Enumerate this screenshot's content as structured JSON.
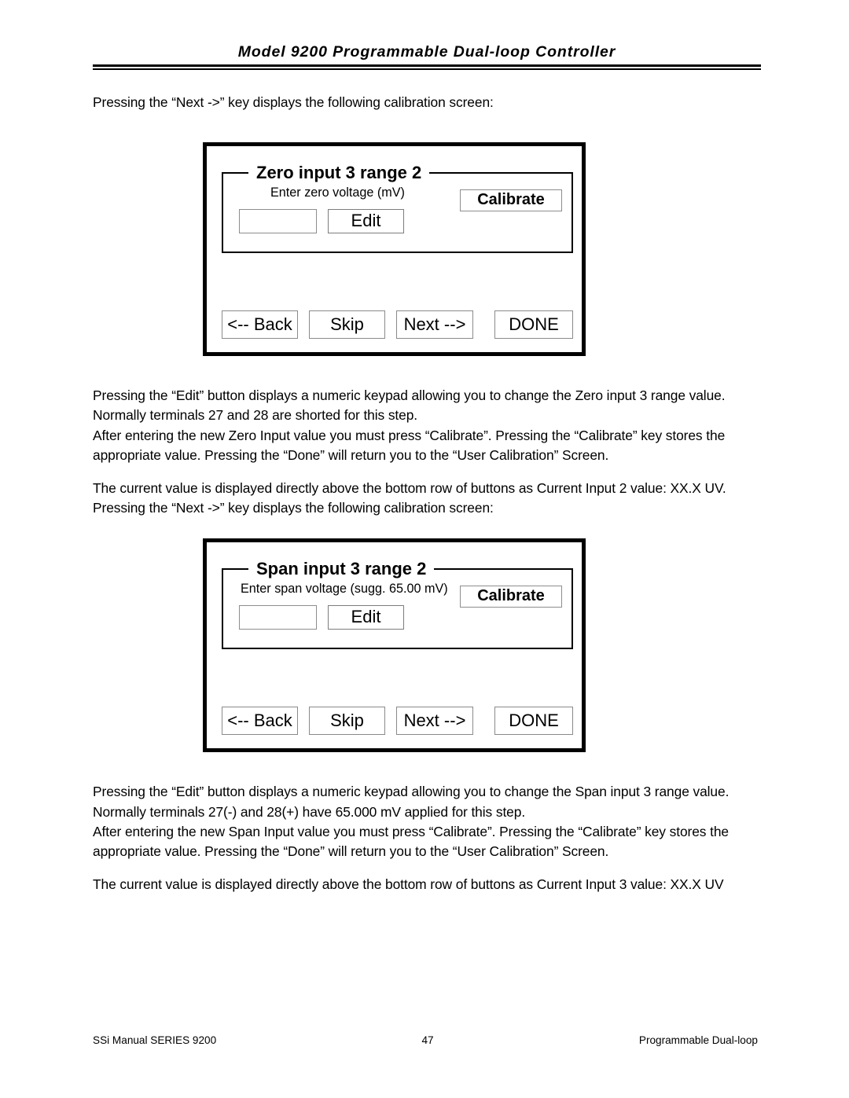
{
  "header": {
    "title": "Model 9200 Programmable Dual-loop Controller"
  },
  "body": {
    "intro_paragraph": "Pressing the “Next ->” key displays the following calibration screen:",
    "zero_paragraph_1": "Pressing the “Edit” button displays a numeric keypad allowing you to change the Zero input 3 range value. Normally terminals 27 and 28 are shorted for this step.",
    "zero_paragraph_2": "After entering the new Zero Input value you must press “Calibrate”. Pressing the “Calibrate” key stores the appropriate value. Pressing the “Done” will return you to the “User Calibration” Screen.",
    "zero_current_value": "The current value is displayed directly above the bottom row of buttons as Current Input 2 value: XX.X UV.",
    "zero_next_prompt": "Pressing the “Next ->” key displays the following calibration screen:",
    "span_paragraph_1": "Pressing the “Edit” button displays a numeric keypad allowing you to change the Span input 3 range value. Normally terminals 27(-) and 28(+) have 65.000 mV applied for this step.",
    "span_paragraph_2": "After entering the new Span Input value you must press “Calibrate”. Pressing the “Calibrate” key stores the appropriate value. Pressing the “Done” will return you to the “User Calibration” Screen.",
    "span_current_value": "The current value is displayed directly above the bottom row of buttons as Current Input 3 value: XX.X UV"
  },
  "dialogs": [
    {
      "legend": "Zero input 3 range 2",
      "prompt": "Enter zero voltage (mV)",
      "value": "",
      "edit_label": "Edit",
      "calibrate_label": "Calibrate",
      "buttons": [
        "<-- Back",
        "Skip",
        "Next -->",
        "DONE"
      ]
    },
    {
      "legend": "Span input 3 range 2",
      "prompt": "Enter span voltage (sugg. 65.00 mV)",
      "value": "",
      "edit_label": "Edit",
      "calibrate_label": "Calibrate",
      "buttons": [
        "<-- Back",
        "Skip",
        "Next -->",
        "DONE"
      ]
    }
  ],
  "footer": {
    "left": "SSi Manual SERIES 9200",
    "page_number": "47",
    "right": "Programmable Dual-loop"
  }
}
